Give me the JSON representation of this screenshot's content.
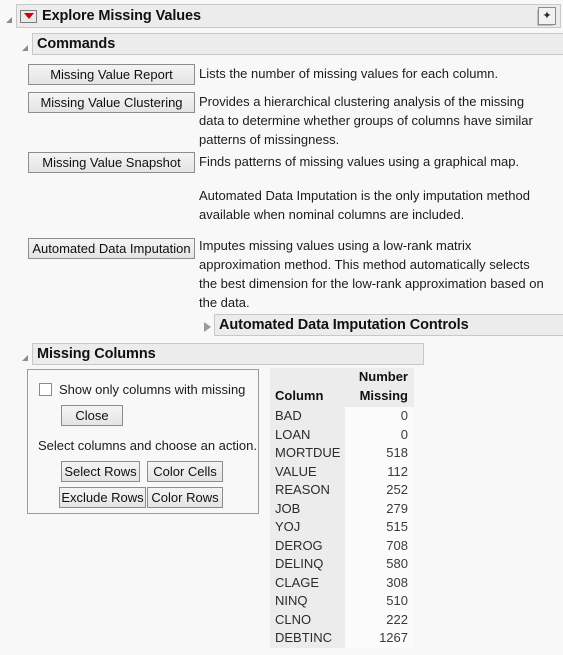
{
  "window": {
    "title": "Explore Missing Values",
    "disclosure_icon": "red-triangle-menu-icon",
    "corner_icon": "star-button-icon",
    "corner_glyph": "✦"
  },
  "commands": {
    "section_title": "Commands",
    "items": [
      {
        "button": "Missing Value Report",
        "description": "Lists the number of missing values for each column."
      },
      {
        "button": "Missing Value Clustering",
        "description": "Provides a hierarchical clustering analysis of the missing data to determine whether groups of columns have similar patterns of missingness."
      },
      {
        "button": "Missing Value Snapshot",
        "description": "Finds patterns of missing values using a graphical map."
      }
    ],
    "note": "Automated Data Imputation is the only imputation method available when nominal columns are included.",
    "imputation": {
      "button": "Automated Data Imputation",
      "description": "Imputes missing values using a low-rank matrix approximation method. This method automatically selects the best dimension for the low-rank approximation based on the data."
    },
    "controls_section_title": "Automated Data Imputation Controls"
  },
  "missing_columns": {
    "section_title": "Missing Columns",
    "checkbox_label": "Show only columns with missing",
    "checkbox_checked": false,
    "close_button": "Close",
    "hint": "Select columns and choose an action.",
    "actions": [
      "Select Rows",
      "Color Cells",
      "Exclude Rows",
      "Color Rows"
    ],
    "table": {
      "headers": {
        "column": "Column",
        "number": "Number",
        "missing": "Missing"
      },
      "rows": [
        {
          "column": "BAD",
          "missing": "0"
        },
        {
          "column": "LOAN",
          "missing": "0"
        },
        {
          "column": "MORTDUE",
          "missing": "518"
        },
        {
          "column": "VALUE",
          "missing": "112"
        },
        {
          "column": "REASON",
          "missing": "252"
        },
        {
          "column": "JOB",
          "missing": "279"
        },
        {
          "column": "YOJ",
          "missing": "515"
        },
        {
          "column": "DEROG",
          "missing": "708"
        },
        {
          "column": "DELINQ",
          "missing": "580"
        },
        {
          "column": "CLAGE",
          "missing": "308"
        },
        {
          "column": "NINQ",
          "missing": "510"
        },
        {
          "column": "CLNO",
          "missing": "222"
        },
        {
          "column": "DEBTINC",
          "missing": "1267"
        }
      ]
    }
  },
  "colors": {
    "background": "#f8f8f8",
    "header_bar": "#ececec",
    "accent_red": "#d40000",
    "border": "#9b9b9b"
  }
}
